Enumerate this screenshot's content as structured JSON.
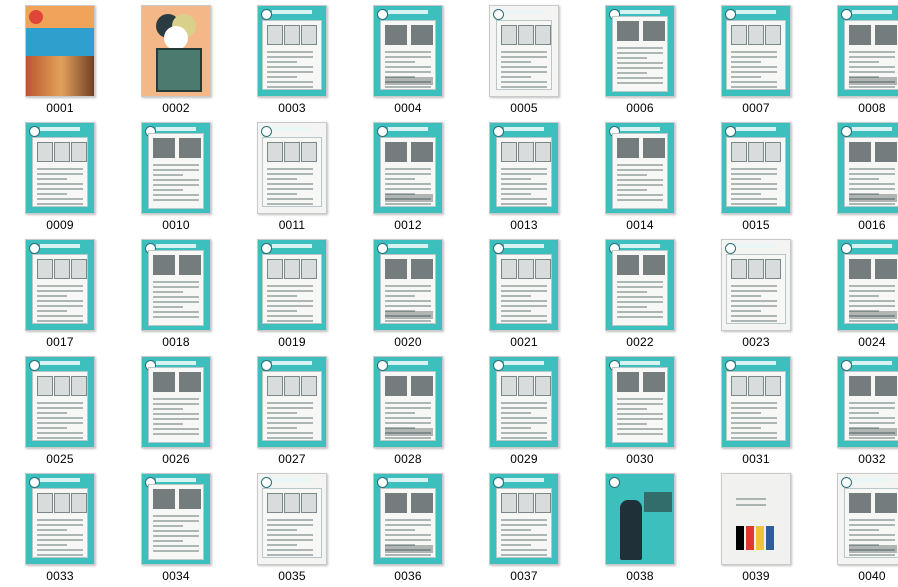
{
  "thumbnails": [
    {
      "label": "0001",
      "style": "cover1"
    },
    {
      "label": "0002",
      "style": "cover2"
    },
    {
      "label": "0003",
      "style": "teal"
    },
    {
      "label": "0004",
      "style": "teal"
    },
    {
      "label": "0005",
      "style": "white"
    },
    {
      "label": "0006",
      "style": "teal"
    },
    {
      "label": "0007",
      "style": "teal"
    },
    {
      "label": "0008",
      "style": "teal"
    },
    {
      "label": "0009",
      "style": "teal"
    },
    {
      "label": "0010",
      "style": "teal"
    },
    {
      "label": "0011",
      "style": "white"
    },
    {
      "label": "0012",
      "style": "teal"
    },
    {
      "label": "0013",
      "style": "teal"
    },
    {
      "label": "0014",
      "style": "teal"
    },
    {
      "label": "0015",
      "style": "teal"
    },
    {
      "label": "0016",
      "style": "teal"
    },
    {
      "label": "0017",
      "style": "teal"
    },
    {
      "label": "0018",
      "style": "teal"
    },
    {
      "label": "0019",
      "style": "teal"
    },
    {
      "label": "0020",
      "style": "teal"
    },
    {
      "label": "0021",
      "style": "teal"
    },
    {
      "label": "0022",
      "style": "teal"
    },
    {
      "label": "0023",
      "style": "white"
    },
    {
      "label": "0024",
      "style": "teal"
    },
    {
      "label": "0025",
      "style": "teal"
    },
    {
      "label": "0026",
      "style": "teal"
    },
    {
      "label": "0027",
      "style": "teal"
    },
    {
      "label": "0028",
      "style": "teal"
    },
    {
      "label": "0029",
      "style": "teal"
    },
    {
      "label": "0030",
      "style": "teal"
    },
    {
      "label": "0031",
      "style": "teal"
    },
    {
      "label": "0032",
      "style": "teal"
    },
    {
      "label": "0033",
      "style": "teal"
    },
    {
      "label": "0034",
      "style": "teal"
    },
    {
      "label": "0035",
      "style": "white"
    },
    {
      "label": "0036",
      "style": "teal"
    },
    {
      "label": "0037",
      "style": "teal"
    },
    {
      "label": "0038",
      "style": "ad"
    },
    {
      "label": "0039",
      "style": "photo"
    },
    {
      "label": "0040",
      "style": "white"
    }
  ],
  "colors": {
    "teal": "#3dbfbd",
    "paper": "#f4f4f2",
    "label_text": "#000000"
  }
}
